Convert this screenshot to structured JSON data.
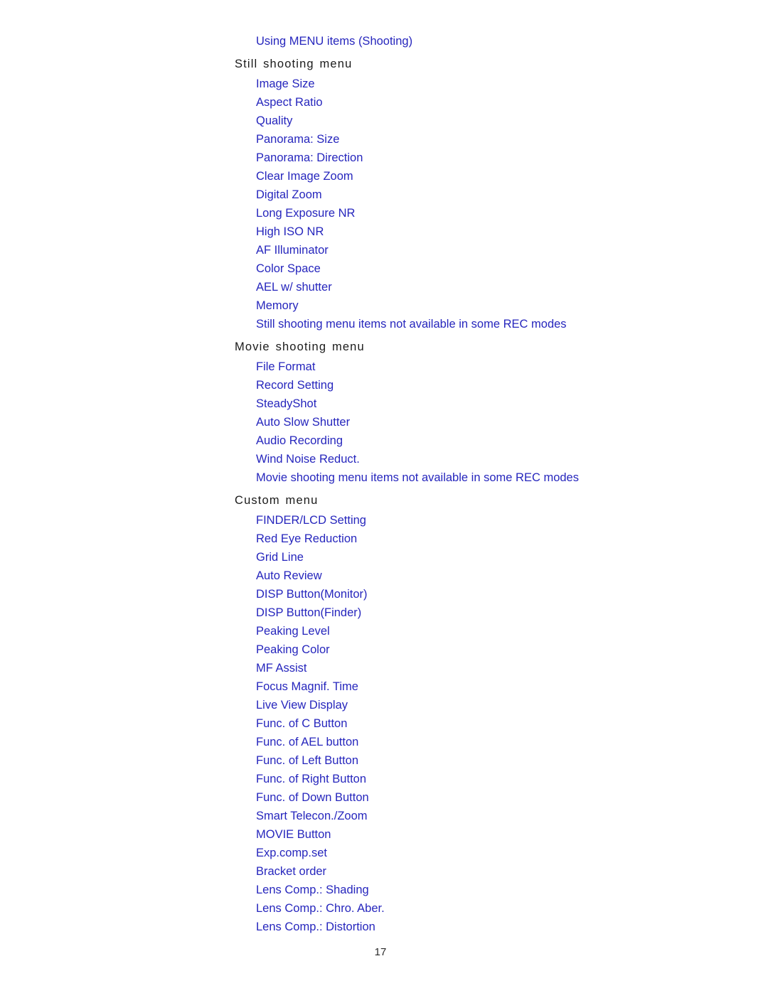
{
  "document": {
    "top_link": "Using MENU items (Shooting)",
    "page_number": "17",
    "link_color": "#2626bd",
    "heading_color": "#1a1a1a",
    "background_color": "#ffffff",
    "sections": [
      {
        "heading": "Still shooting menu",
        "items": [
          "Image Size",
          "Aspect Ratio",
          "Quality",
          "Panorama: Size",
          "Panorama: Direction",
          "Clear Image Zoom",
          "Digital Zoom",
          "Long Exposure NR",
          "High ISO NR",
          "AF Illuminator",
          "Color Space",
          "AEL w/ shutter",
          "Memory",
          "Still shooting menu items not available in some REC modes"
        ]
      },
      {
        "heading": "Movie shooting menu",
        "items": [
          "File Format",
          "Record Setting",
          "SteadyShot",
          "Auto Slow Shutter",
          "Audio Recording",
          "Wind Noise Reduct.",
          "Movie shooting menu items not available in some REC modes"
        ]
      },
      {
        "heading": "Custom menu",
        "items": [
          "FINDER/LCD Setting",
          "Red Eye Reduction",
          "Grid Line",
          "Auto Review",
          "DISP Button(Monitor)",
          "DISP Button(Finder)",
          "Peaking Level",
          "Peaking Color",
          "MF Assist",
          "Focus Magnif. Time",
          "Live View Display",
          "Func. of C Button",
          "Func. of AEL button",
          "Func. of Left Button",
          "Func. of Right Button",
          "Func. of Down Button",
          "Smart Telecon./Zoom",
          "MOVIE Button",
          "Exp.comp.set",
          "Bracket order",
          "Lens Comp.: Shading",
          "Lens Comp.: Chro. Aber.",
          "Lens Comp.: Distortion"
        ]
      }
    ]
  }
}
